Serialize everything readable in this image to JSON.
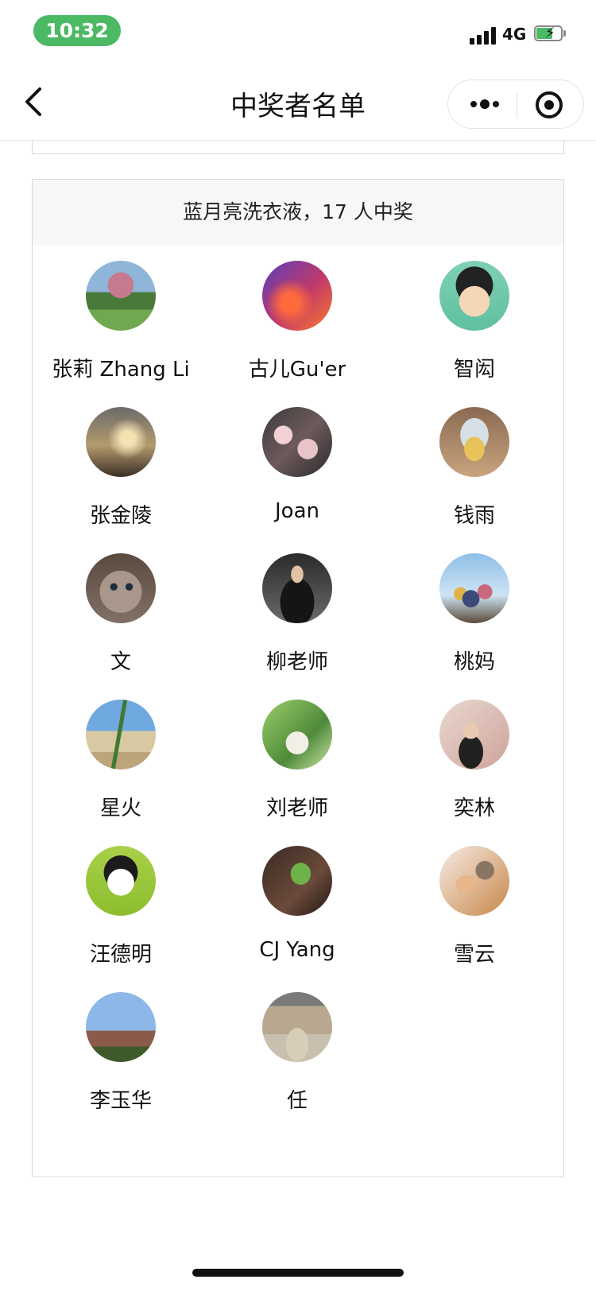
{
  "status_bar": {
    "time": "10:32",
    "network": "4G"
  },
  "nav": {
    "title": "中奖者名单"
  },
  "card": {
    "header": "蓝月亮洗衣液，17 人中奖",
    "winners": [
      {
        "name": "张莉 Zhang Li",
        "avatar": "photo-tree-person"
      },
      {
        "name": "古儿Gu'er",
        "avatar": "photo-sunset-clouds"
      },
      {
        "name": "智闳",
        "avatar": "cartoon-boy-glasses"
      },
      {
        "name": "张金陵",
        "avatar": "photo-sunset-balloon"
      },
      {
        "name": "Joan",
        "avatar": "photo-cherry-blossom"
      },
      {
        "name": "钱雨",
        "avatar": "photo-glass-flowers"
      },
      {
        "name": "文",
        "avatar": "photo-kitten"
      },
      {
        "name": "柳老师",
        "avatar": "photo-woman-black"
      },
      {
        "name": "桃妈",
        "avatar": "photo-balloons-sky"
      },
      {
        "name": "星火",
        "avatar": "photo-plant-beach"
      },
      {
        "name": "刘老师",
        "avatar": "photo-hat-leaves"
      },
      {
        "name": "奕林",
        "avatar": "photo-woman-selfie"
      },
      {
        "name": "汪德明",
        "avatar": "cartoon-man-green"
      },
      {
        "name": "CJ Yang",
        "avatar": "photo-green-sprout"
      },
      {
        "name": "雪云",
        "avatar": "photo-woman-cat"
      },
      {
        "name": "李玉华",
        "avatar": "photo-building-sky"
      },
      {
        "name": "任",
        "avatar": "photo-courtyard"
      }
    ]
  }
}
